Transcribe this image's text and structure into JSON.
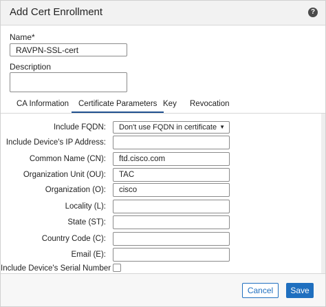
{
  "dialog": {
    "title": "Add Cert Enrollment",
    "help_icon_glyph": "?"
  },
  "name_field": {
    "label": "Name*",
    "value": "RAVPN-SSL-cert"
  },
  "description_field": {
    "label": "Description",
    "value": ""
  },
  "tabs": [
    {
      "label": "CA Information",
      "active": false
    },
    {
      "label": "Certificate Parameters",
      "active": true
    },
    {
      "label": "Key",
      "active": false
    },
    {
      "label": "Revocation",
      "active": false
    }
  ],
  "form": {
    "include_fqdn": {
      "label": "Include FQDN:",
      "selected": "Don't use FQDN in certificate"
    },
    "ip_address": {
      "label": "Include Device's IP Address:",
      "value": ""
    },
    "common_name": {
      "label": "Common Name (CN):",
      "value": "ftd.cisco.com"
    },
    "org_unit": {
      "label": "Organization Unit (OU):",
      "value": "TAC"
    },
    "organization": {
      "label": "Organization (O):",
      "value": "cisco"
    },
    "locality": {
      "label": "Locality (L):",
      "value": ""
    },
    "state": {
      "label": "State (ST):",
      "value": ""
    },
    "country_code": {
      "label": "Country Code (C):",
      "value": ""
    },
    "email": {
      "label": "Email (E):",
      "value": ""
    },
    "serial_number": {
      "label": "Include Device's Serial Number",
      "checked": false
    }
  },
  "footer": {
    "cancel_label": "Cancel",
    "save_label": "Save"
  },
  "colors": {
    "accent": "#1f6fbf",
    "active_tab_underline": "#1f4f8f",
    "header_bg": "#f2f2f2"
  }
}
